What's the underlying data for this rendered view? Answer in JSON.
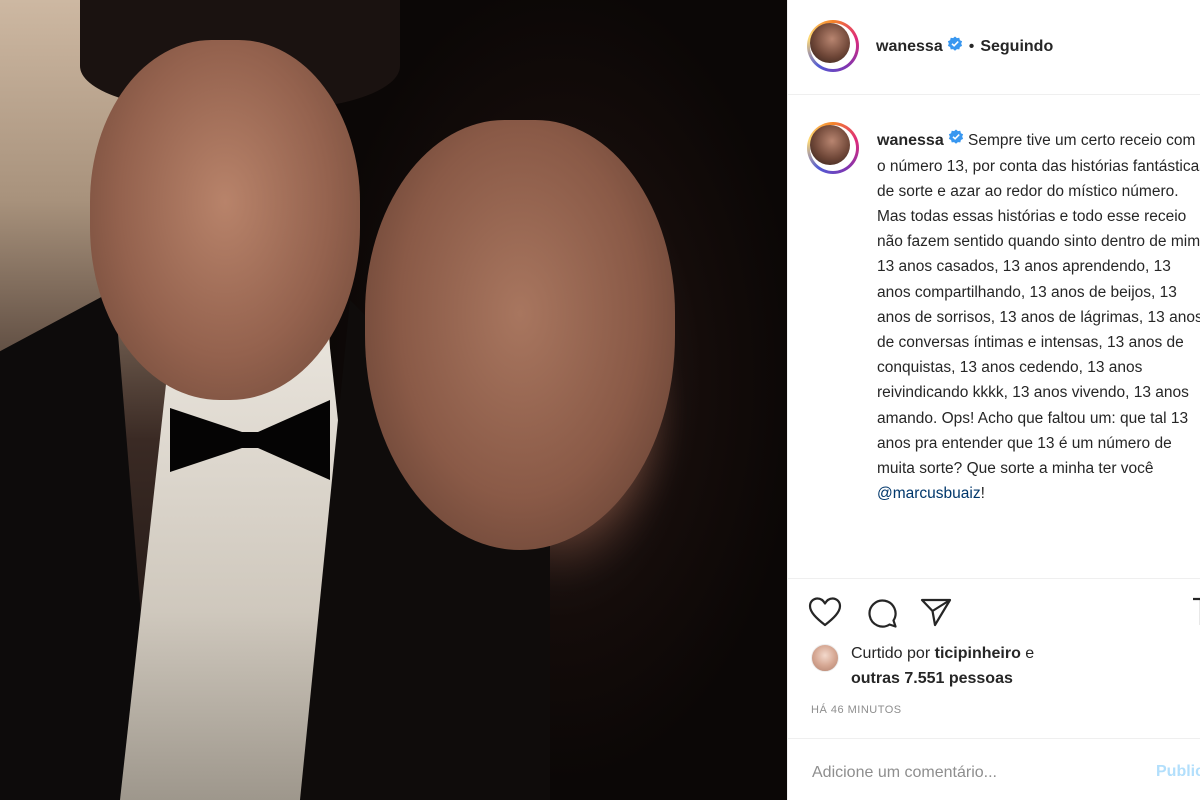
{
  "post": {
    "photo_alt": "",
    "header": {
      "username": "wanessa",
      "separator": "•",
      "follow_status": "Seguindo"
    },
    "caption": {
      "username": "wanessa",
      "text_before_mention": "Sempre tive um certo receio com o número 13, por conta das histórias fantásticas de sorte e azar ao redor do místico número. Mas todas essas histórias e todo esse receio não fazem sentido quando sinto dentro de mim: 13 anos casados, 13 anos aprendendo, 13 anos compartilhando, 13 anos de beijos, 13 anos de sorrisos, 13 anos de lágrimas, 13 anos de conversas íntimas e intensas, 13 anos de conquistas, 13 anos cedendo, 13 anos reivindicando kkkk, 13 anos vivendo, 13 anos amando. Ops! Acho que faltou um: que tal 13 anos pra entender que 13 é um número de muita sorte? Que sorte a minha ter você ",
      "mention": "@marcusbuaiz",
      "text_after_mention": "!"
    },
    "actions": {
      "icons": [
        "heart-icon",
        "comment-icon",
        "share-icon",
        "bookmark-icon"
      ]
    },
    "likes": {
      "prefix": "Curtido por",
      "liker": "ticipinheiro",
      "connector": "e",
      "others": "outras 7.551 pessoas"
    },
    "timestamp": "HÁ 46 MINUTOS",
    "comment_box": {
      "placeholder": "Adicione um comentário...",
      "publish_label": "Publicar"
    }
  },
  "colors": {
    "verified": "#3897f0",
    "link": "#00376b",
    "muted": "#8e8e8e",
    "publish_disabled": "#b2dffc",
    "border": "#efefef"
  }
}
